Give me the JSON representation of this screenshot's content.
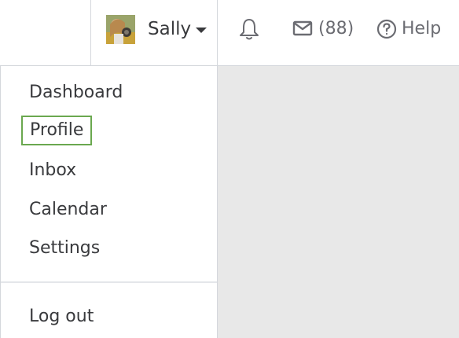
{
  "header": {
    "user": {
      "name": "Sally",
      "avatar_icon": "user-avatar-photo",
      "caret_icon": "caret-down-icon"
    },
    "notifications": {
      "icon": "bell-icon"
    },
    "messages": {
      "icon": "mail-icon",
      "count_label": "(88)"
    },
    "help": {
      "icon": "question-circle-icon",
      "label": "Help"
    }
  },
  "dropdown": {
    "items": [
      {
        "label": "Dashboard"
      },
      {
        "label": "Profile"
      },
      {
        "label": "Inbox"
      },
      {
        "label": "Calendar"
      },
      {
        "label": "Settings"
      }
    ],
    "logout_label": "Log out",
    "focused_item": "Profile"
  },
  "colors": {
    "text": "#393a3d",
    "muted": "#6b6c72",
    "focus_ring": "#6aa84f",
    "border": "#d4d7dc",
    "background_panel": "#e8e8e8"
  }
}
